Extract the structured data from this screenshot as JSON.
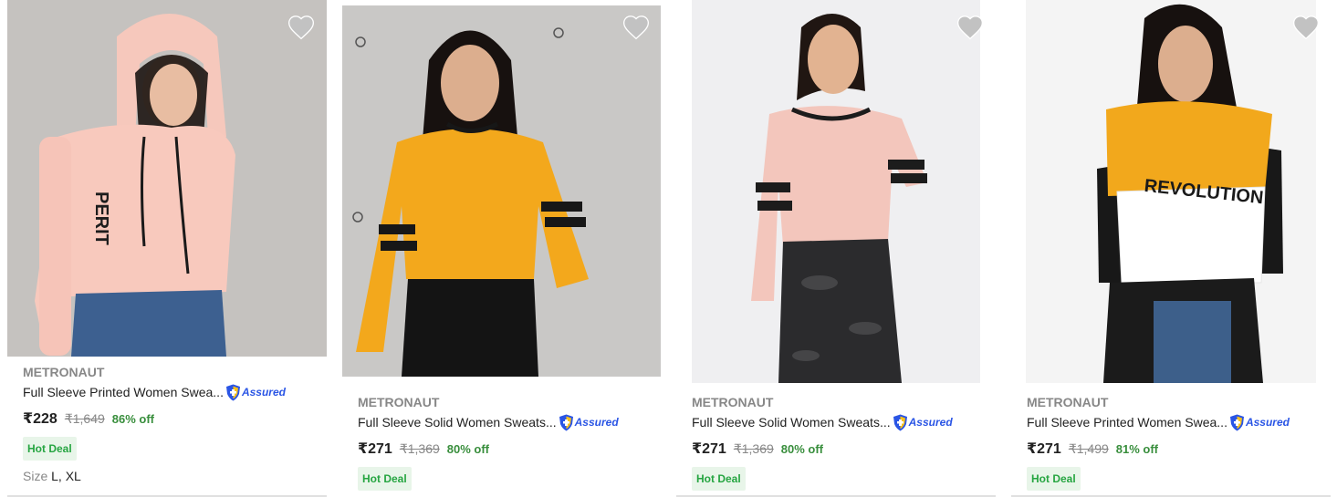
{
  "products": [
    {
      "brand": "METRONAUT",
      "title": "Full Sleeve Printed Women Swea...",
      "assured": "Assured",
      "price": "₹228",
      "mrp": "₹1,649",
      "discount": "86% off",
      "badge": "Hot Deal",
      "size_label": "Size",
      "sizes": "L, XL",
      "image_desc_colors": {
        "top": "#f6c7bb",
        "bottom": "#3a5a86"
      }
    },
    {
      "brand": "METRONAUT",
      "title": "Full Sleeve Solid Women Sweats...",
      "assured": "Assured",
      "price": "₹271",
      "mrp": "₹1,369",
      "discount": "80% off",
      "badge": "Hot Deal",
      "image_desc_colors": {
        "top": "#f0a51c",
        "bottom": "#151515"
      }
    },
    {
      "brand": "METRONAUT",
      "title": "Full Sleeve Solid Women Sweats...",
      "assured": "Assured",
      "price": "₹271",
      "mrp": "₹1,369",
      "discount": "80% off",
      "badge": "Hot Deal",
      "image_desc_colors": {
        "top": "#f3c7bd",
        "bottom": "#2a2a2c"
      }
    },
    {
      "brand": "METRONAUT",
      "title": "Full Sleeve Printed Women Swea...",
      "assured": "Assured",
      "price": "₹271",
      "mrp": "₹1,499",
      "discount": "81% off",
      "badge": "Hot Deal",
      "print_text": "REVOLUTION",
      "image_desc_colors": {
        "top": "#f2a81d",
        "bottom": "#ffffff"
      }
    }
  ],
  "colors": {
    "discount_green": "#388e3c",
    "badge_bg": "#e8f5e9",
    "badge_text": "#26a541",
    "assured_blue": "#2a55e5",
    "wishlist_grey": "#c2c2c2"
  },
  "icons": {
    "wishlist": "heart-icon",
    "assured": "shield-plus-icon"
  }
}
